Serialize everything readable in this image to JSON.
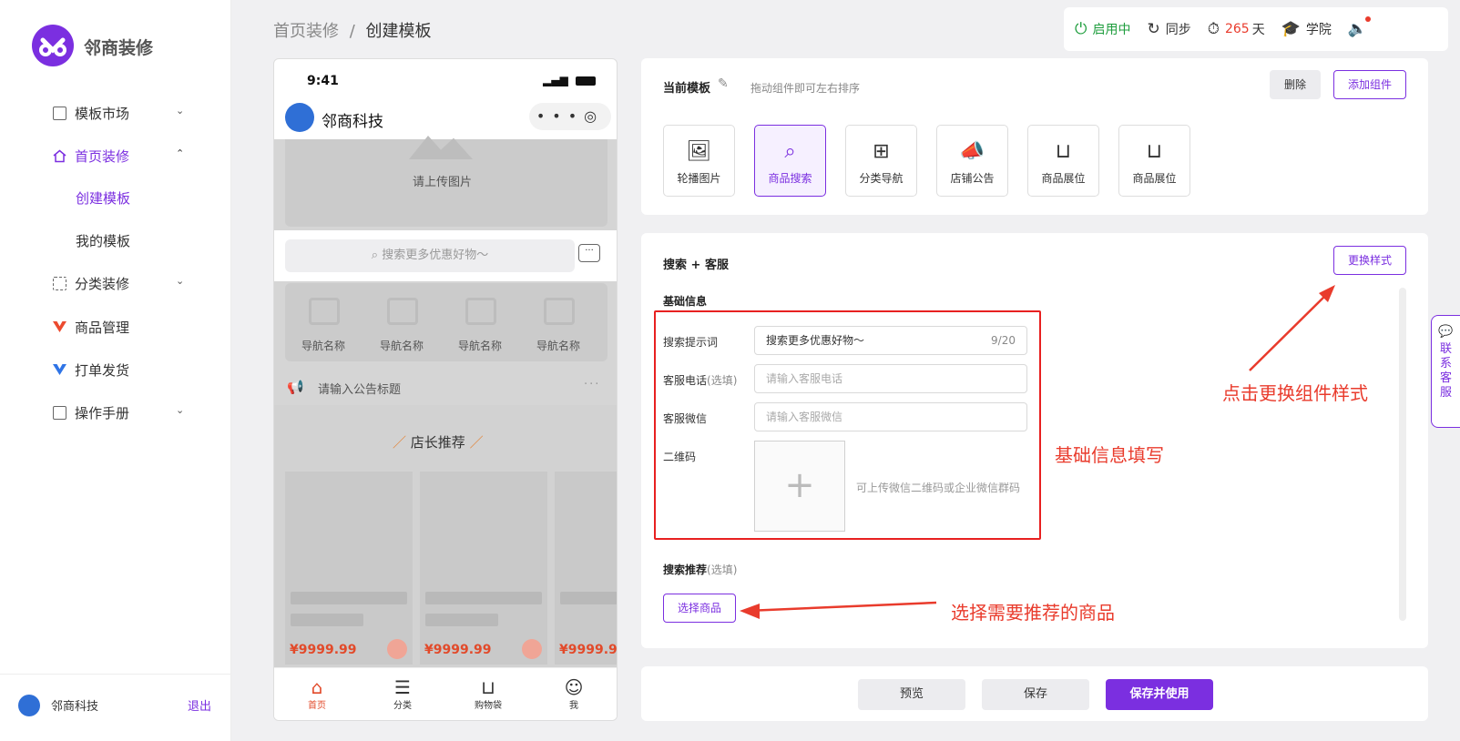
{
  "app": {
    "brand": "邻商装修"
  },
  "sidebar": {
    "items": [
      {
        "label": "模板市场",
        "icon": "template-icon",
        "has_chevron": true,
        "chevron": "⌄"
      },
      {
        "label": "首页装修",
        "icon": "home-icon",
        "has_chevron": true,
        "chevron": "⌃"
      },
      {
        "label": "创建模板"
      },
      {
        "label": "我的模板"
      },
      {
        "label": "分类装修",
        "icon": "category-icon",
        "has_chevron": true,
        "chevron": "⌄"
      },
      {
        "label": "商品管理",
        "icon": "goods-icon"
      },
      {
        "label": "打单发货",
        "icon": "shipping-icon"
      },
      {
        "label": "操作手册",
        "icon": "manual-icon",
        "has_chevron": true,
        "chevron": "⌄"
      }
    ],
    "footer": {
      "company": "邻商科技",
      "logout": "退出"
    }
  },
  "breadcrumb": {
    "parent": "首页装修",
    "sep": "/",
    "current": "创建模板"
  },
  "topbar": {
    "status": "启用中",
    "sync": "同步",
    "days_num": "265",
    "days_unit": "天",
    "academy": "学院"
  },
  "phone": {
    "time": "9:41",
    "shop_name": "邻商科技",
    "upload_image": "请上传图片",
    "search_placeholder": "搜索更多优惠好物～",
    "nav_items": [
      "导航名称",
      "导航名称",
      "导航名称",
      "导航名称"
    ],
    "notice_placeholder": "请输入公告标题",
    "recommend_title": "店长推荐",
    "price": "¥9999.99",
    "tabs": [
      "首页",
      "分类",
      "购物袋",
      "我"
    ]
  },
  "template_panel": {
    "title": "当前模板",
    "hint": "拖动组件即可左右排序",
    "delete": "删除",
    "add_component": "添加组件",
    "components": [
      {
        "label": "轮播图片",
        "icon": "image-icon"
      },
      {
        "label": "商品搜索",
        "icon": "search-icon",
        "selected": true
      },
      {
        "label": "分类导航",
        "icon": "grid-icon"
      },
      {
        "label": "店铺公告",
        "icon": "megaphone-icon"
      },
      {
        "label": "商品展位",
        "icon": "bag-icon"
      },
      {
        "label": "商品展位",
        "icon": "bag-icon"
      }
    ]
  },
  "config_panel": {
    "title": "搜索 + 客服",
    "change_style": "更换样式",
    "basic_info": "基础信息",
    "fields": [
      {
        "label": "搜索提示词",
        "value": "搜索更多优惠好物～",
        "counter": "9/20"
      },
      {
        "label": "客服电话",
        "optional": "(选填)",
        "placeholder": "请输入客服电话"
      },
      {
        "label": "客服微信",
        "placeholder": "请输入客服微信"
      },
      {
        "label": "二维码",
        "hint": "可上传微信二维码或企业微信群码"
      }
    ],
    "recommend_label": "搜索推荐",
    "recommend_optional": "(选填)",
    "select_goods": "选择商品"
  },
  "annotations": {
    "change_style": "点击更换组件样式",
    "basic_info": "基础信息填写",
    "select_goods": "选择需要推荐的商品"
  },
  "footer_buttons": {
    "preview": "预览",
    "save": "保存",
    "save_use": "保存并使用"
  },
  "contact": "联系客服",
  "colors": {
    "accent": "#7b2fe0",
    "annotation": "#e93b2c",
    "active_green": "#1e9d3d"
  }
}
